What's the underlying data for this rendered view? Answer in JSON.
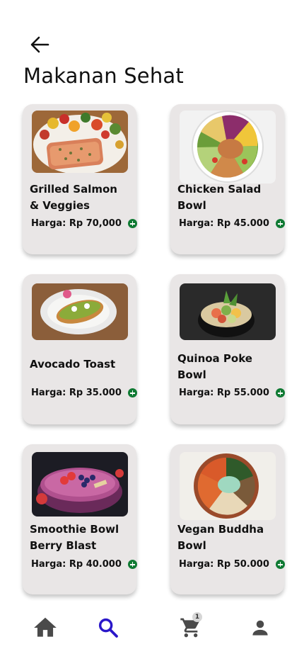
{
  "header": {
    "title": "Makanan Sehat",
    "back_icon": "arrow-left-icon"
  },
  "products": [
    {
      "name": "Grilled Salmon & Veggies",
      "price": "Harga: Rp 70,000"
    },
    {
      "name": "Chicken Salad Bowl",
      "price": "Harga: Rp 45.000"
    },
    {
      "name": "Avocado Toast",
      "price": "Harga: Rp 35.000"
    },
    {
      "name": "Quinoa Poke Bowl",
      "price": "Harga: Rp 55.000"
    },
    {
      "name": "Smoothie Bowl Berry Blast",
      "price": "Harga: Rp 40.000"
    },
    {
      "name": "Vegan Buddha Bowl",
      "price": "Harga: Rp 50.000"
    }
  ],
  "nav": {
    "items": [
      "home-icon",
      "search-icon",
      "cart-icon",
      "profile-icon"
    ],
    "active": "search",
    "cart_count": "1",
    "colors": {
      "active": "#2a17c9",
      "inactive": "#4a4a4a"
    }
  },
  "colors": {
    "card_bg": "#e9e6e6",
    "add_button": "#0f7a33"
  }
}
